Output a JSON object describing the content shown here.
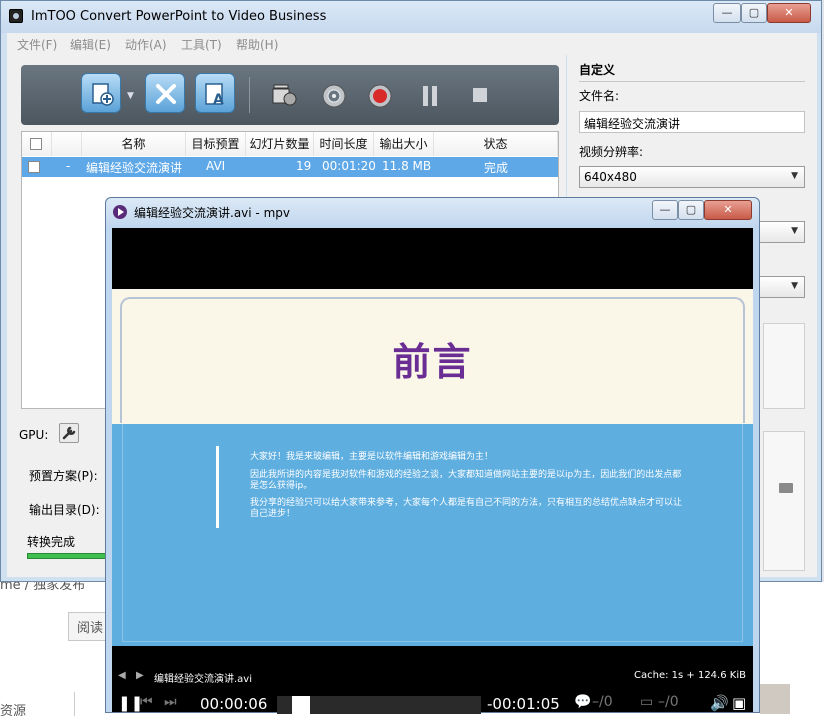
{
  "main_window": {
    "title": "ImTOO Convert PowerPoint to Video Business",
    "controls": {
      "minimize": "—",
      "maximize": "▢",
      "close": "✕"
    }
  },
  "menubar": [
    "文件(F)",
    "编辑(E)",
    "动作(A)",
    "工具(T)",
    "帮助(H)"
  ],
  "toolbar": {
    "icons": [
      "add-file-icon",
      "remove-icon",
      "add-text-icon",
      "video-camera-icon",
      "settings-wheel-icon",
      "record-icon",
      "pause-icon",
      "stop-icon"
    ],
    "record_color": "#d92a2a"
  },
  "file_table": {
    "headers": [
      "名称",
      "目标预置",
      "幻灯片数量",
      "时间长度",
      "输出大小",
      "状态"
    ],
    "rows": [
      {
        "dash": "-",
        "name": "编辑经验交流演讲",
        "preset": "AVI",
        "slides": "19",
        "duration": "00:01:20",
        "size": "11.8 MB",
        "status": "完成"
      }
    ]
  },
  "bottom": {
    "gpu_label": "GPU:",
    "preset_label": "预置方案(P):",
    "output_label": "输出目录(D):",
    "status_text": "转换完成",
    "progress": 1.0
  },
  "right_panel": {
    "heading": "自定义",
    "filename_label": "文件名:",
    "filename_value": "编辑经验交流演讲",
    "resolution_label": "视频分辨率:",
    "resolution_value": "640x480"
  },
  "mpv": {
    "title": "编辑经验交流演讲.avi - mpv",
    "slide": {
      "title": "前言",
      "paragraphs": [
        "大家好！我是来玻编辑，主要是以软件编辑和游戏编辑为主！",
        "因此我所讲的内容是我对软件和游戏的经验之谈，大家都知道做网站主要的是以ip为主，因此我们的出发点都是怎么获得ip。",
        "我分享的经验只可以给大家带来参考，大家每个人都是有自己不同的方法，只有相互的总结优点缺点才可以让自己进步！"
      ],
      "title_color": "#6a2d94",
      "body_color": "#5eaee0"
    },
    "osc": {
      "filename": "编辑经验交流演讲.avi",
      "cache": "Cache:   1s + 124.6 KiB",
      "time_elapsed": "00:00:06",
      "time_remaining": "-00:01:05",
      "sub_track": "–/0",
      "audio_track": "–/0",
      "progress": 0.08
    }
  },
  "background": {
    "snippet": "me / 独家发布",
    "button": "阅读",
    "left_text": "资源"
  }
}
